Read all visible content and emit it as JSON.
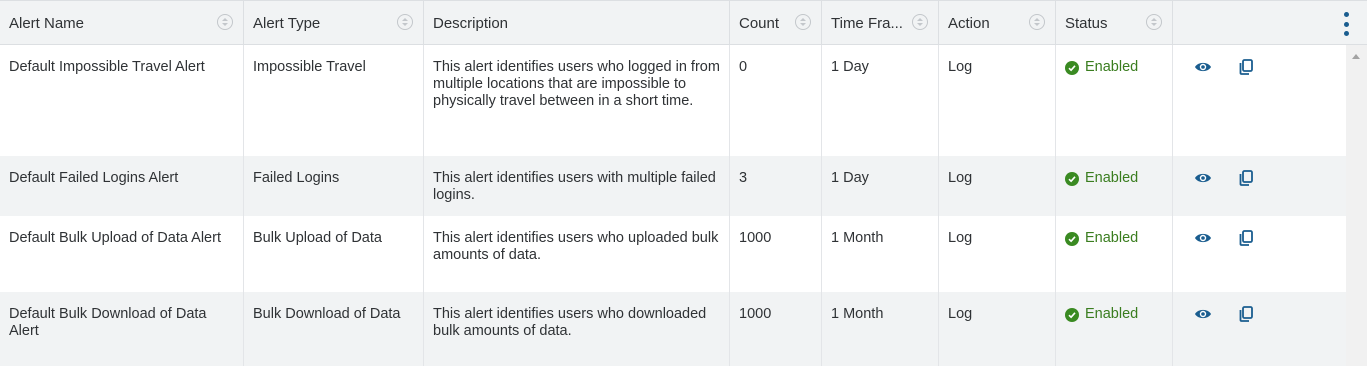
{
  "columns": [
    {
      "label": "Alert Name",
      "sortable": true
    },
    {
      "label": "Alert Type",
      "sortable": true
    },
    {
      "label": "Description",
      "sortable": false
    },
    {
      "label": "Count",
      "sortable": true
    },
    {
      "label": "Time Fra...",
      "sortable": true
    },
    {
      "label": "Action",
      "sortable": true
    },
    {
      "label": "Status",
      "sortable": true
    }
  ],
  "rows": [
    {
      "name": "Default Impossible Travel Alert",
      "type": "Impossible Travel",
      "description": "This alert identifies users who logged in from multiple locations that are impossible to physically travel between in a short time.",
      "count": "0",
      "time_frame": "1 Day",
      "action": "Log",
      "status": "Enabled"
    },
    {
      "name": "Default Failed Logins Alert",
      "type": "Failed Logins",
      "description": "This alert identifies users with multiple failed logins.",
      "count": "3",
      "time_frame": "1 Day",
      "action": "Log",
      "status": "Enabled"
    },
    {
      "name": "Default Bulk Upload of Data Alert",
      "type": "Bulk Upload of Data",
      "description": "This alert identifies users who uploaded bulk amounts of data.",
      "count": "1000",
      "time_frame": "1 Month",
      "action": "Log",
      "status": "Enabled"
    },
    {
      "name": "Default Bulk Download of Data Alert",
      "type": "Bulk Download of Data",
      "description": "This alert identifies users who downloaded bulk amounts of data.",
      "count": "1000",
      "time_frame": "1 Month",
      "action": "Log",
      "status": "Enabled"
    }
  ],
  "icons": {
    "view": "eye-icon",
    "copy": "copy-icon",
    "status": "check-circle-icon",
    "sort": "sort-icon",
    "menu": "kebab-menu-icon"
  },
  "colors": {
    "header_bg": "#f1f3f4",
    "accent": "#1a5d8f",
    "enabled": "#3a8a22"
  }
}
